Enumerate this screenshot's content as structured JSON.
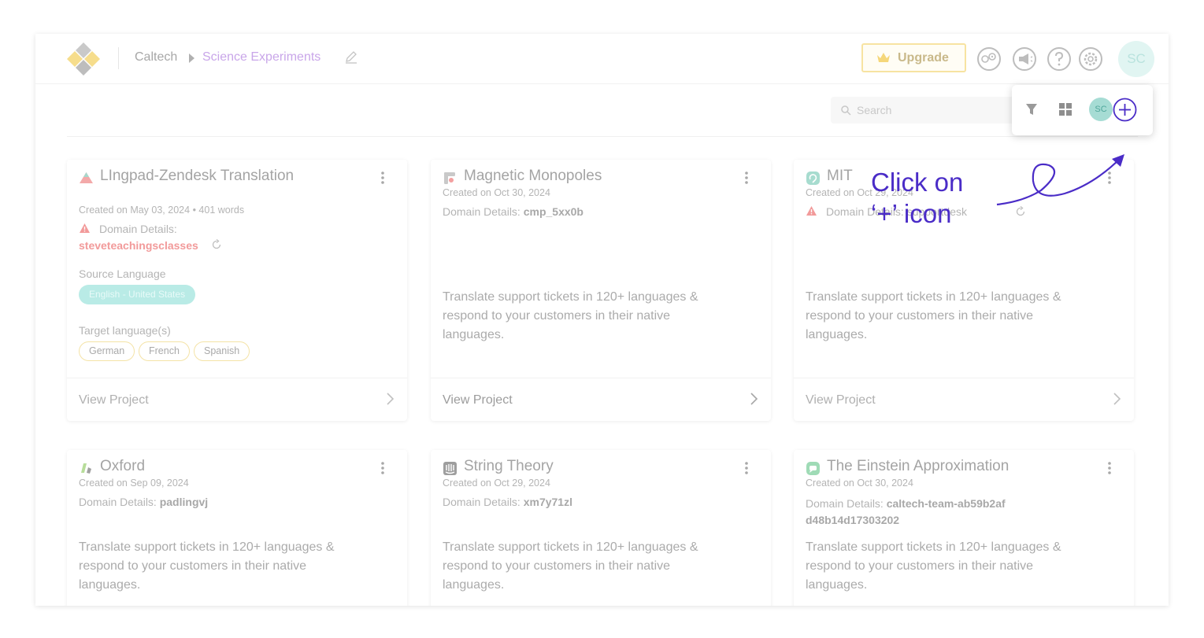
{
  "header": {
    "org": "Caltech",
    "project": "Science Experiments",
    "upgrade_label": "Upgrade",
    "avatar_initials": "SC"
  },
  "search": {
    "placeholder": "Search"
  },
  "toolbar_popup": {
    "avatar_initials": "SC"
  },
  "callout": {
    "line1": "Click on",
    "line2": "‘+’ icon"
  },
  "cards": [
    {
      "title": "LIngpad-Zendesk Translation",
      "created": "Created on May 03, 2024",
      "words": "401 words",
      "domain_label": "Domain Details:",
      "domain_value": "steveteachingsclasses",
      "source_label": "Source Language",
      "source_lang": "English - United States",
      "target_label": "Target language(s)",
      "targets": [
        "German",
        "French",
        "Spanish"
      ],
      "footer": "View Project"
    },
    {
      "title": "Magnetic Monopoles",
      "created": "Created on Oct 30, 2024",
      "domain_label": "Domain Details:",
      "domain_value": "cmp_5xx0b",
      "description": "Translate support tickets in 120+ languages & respond to your customers in their native languages.",
      "footer": "View Project"
    },
    {
      "title": "MIT",
      "created": "Created on Oct 29, 2024",
      "domain_label": "Domain Details:",
      "domain_value": "supportdesk",
      "description": "Translate support tickets in 120+ languages & respond to your customers in their native languages.",
      "footer": "View Project"
    },
    {
      "title": "Oxford",
      "created": "Created on Sep 09, 2024",
      "domain_label": "Domain Details:",
      "domain_value": "padlingvj",
      "description": "Translate support tickets in 120+ languages & respond to your customers in their native languages."
    },
    {
      "title": "String Theory",
      "created": "Created on Oct 29, 2024",
      "domain_label": "Domain Details:",
      "domain_value": "xm7y71zl",
      "description": "Translate support tickets in 120+ languages & respond to your customers in their native languages."
    },
    {
      "title": "The Einstein Approximation",
      "created": "Created on Oct 30, 2024",
      "domain_label": "Domain Details:",
      "domain_value": "caltech-team-ab59b2afd48b14d17303202",
      "description": "Translate support tickets in 120+ languages & respond to your customers in their native languages."
    }
  ],
  "colors": {
    "accent": "#4a2cc7",
    "project_link": "#c9a6e9",
    "warning": "#f29a9a"
  }
}
